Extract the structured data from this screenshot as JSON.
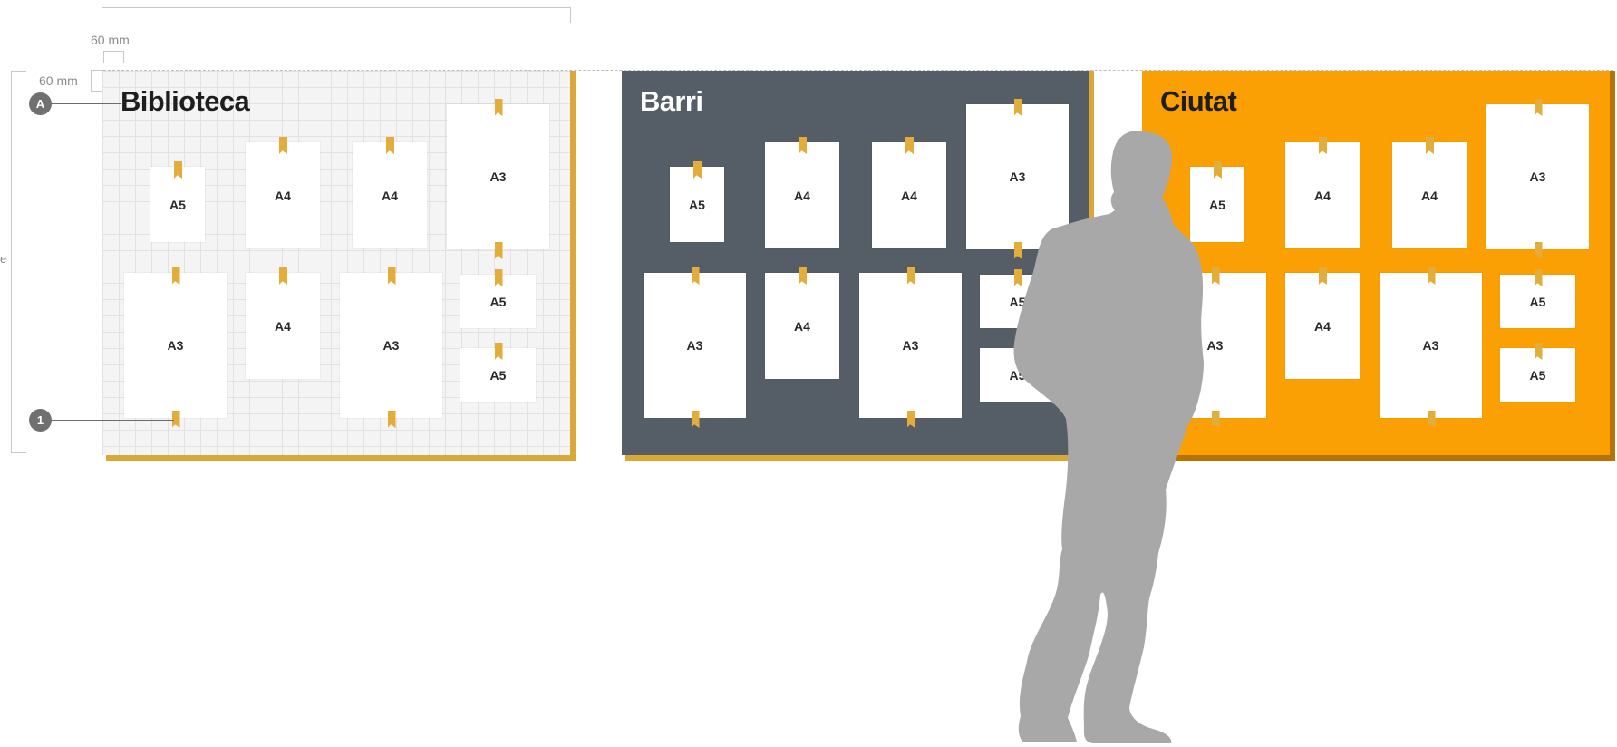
{
  "annotations": {
    "top_margin_label": "60 mm",
    "side_margin_label": "60 mm",
    "height_label": "e"
  },
  "callouts": [
    {
      "id": "A",
      "label": "A"
    },
    {
      "id": "1",
      "label": "1"
    }
  ],
  "boards": [
    {
      "title": "Biblioteca",
      "theme": "light",
      "colors": {
        "background": "#f4f4f4",
        "edge": "#dba838"
      },
      "posters": [
        {
          "format": "A5"
        },
        {
          "format": "A4"
        },
        {
          "format": "A4"
        },
        {
          "format": "A3"
        },
        {
          "format": "A3"
        },
        {
          "format": "A4"
        },
        {
          "format": "A3"
        },
        {
          "format": "A5"
        },
        {
          "format": "A5"
        }
      ]
    },
    {
      "title": "Barri",
      "theme": "dark",
      "colors": {
        "background": "#555d66",
        "edge": "#dba838"
      },
      "posters": [
        {
          "format": "A5"
        },
        {
          "format": "A4"
        },
        {
          "format": "A4"
        },
        {
          "format": "A3"
        },
        {
          "format": "A3"
        },
        {
          "format": "A4"
        },
        {
          "format": "A3"
        },
        {
          "format": "A5"
        },
        {
          "format": "A5"
        }
      ]
    },
    {
      "title": "Ciutat",
      "theme": "orange",
      "colors": {
        "background": "#fba004",
        "edge": "#b67303"
      },
      "posters": [
        {
          "format": "A5"
        },
        {
          "format": "A4"
        },
        {
          "format": "A4"
        },
        {
          "format": "A3"
        },
        {
          "format": "A3"
        },
        {
          "format": "A4"
        },
        {
          "format": "A3"
        },
        {
          "format": "A5"
        },
        {
          "format": "A5"
        }
      ]
    }
  ],
  "colors": {
    "tape": "#e2ad3a",
    "person": "#a8a8a8",
    "annotation": "#8a8a8a"
  },
  "icons": {
    "person": "person-silhouette-icon",
    "tape": "tape-icon"
  }
}
